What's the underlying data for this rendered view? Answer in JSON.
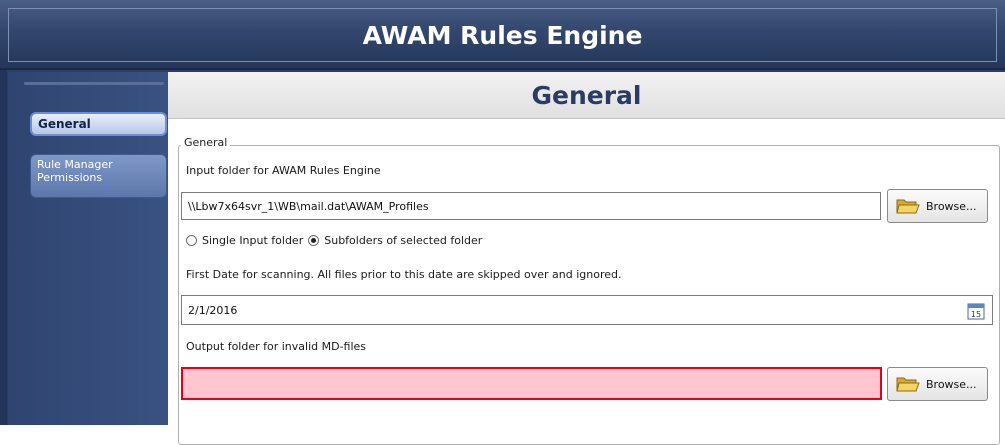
{
  "window": {
    "title": "AWAM Rules Engine"
  },
  "sidebar": {
    "items": [
      {
        "label": "General",
        "selected": true
      },
      {
        "label": "Rule Manager Permissions",
        "selected": false
      }
    ]
  },
  "main": {
    "page_title": "General",
    "group": {
      "legend": "General",
      "input_folder_label": "Input folder for AWAM Rules Engine",
      "input_folder_value": "\\\\Lbw7x64svr_1\\WB\\mail.dat\\AWAM_Profiles",
      "browse_label": "Browse...",
      "radio_options": [
        {
          "label": "Single Input folder",
          "checked": false
        },
        {
          "label": "Subfolders of selected folder",
          "checked": true
        }
      ],
      "first_date_label": "First Date for scanning. All files prior to this date are skipped over and ignored.",
      "first_date_value": "2/1/2016",
      "calendar_day": "15",
      "output_folder_label": "Output folder for invalid MD-files",
      "output_folder_value": "",
      "output_browse_label": "Browse..."
    }
  },
  "colors": {
    "title_bar": "#2d3e60",
    "invalid_field_fill": "#ffc6cf",
    "invalid_field_border": "#e8001b"
  }
}
